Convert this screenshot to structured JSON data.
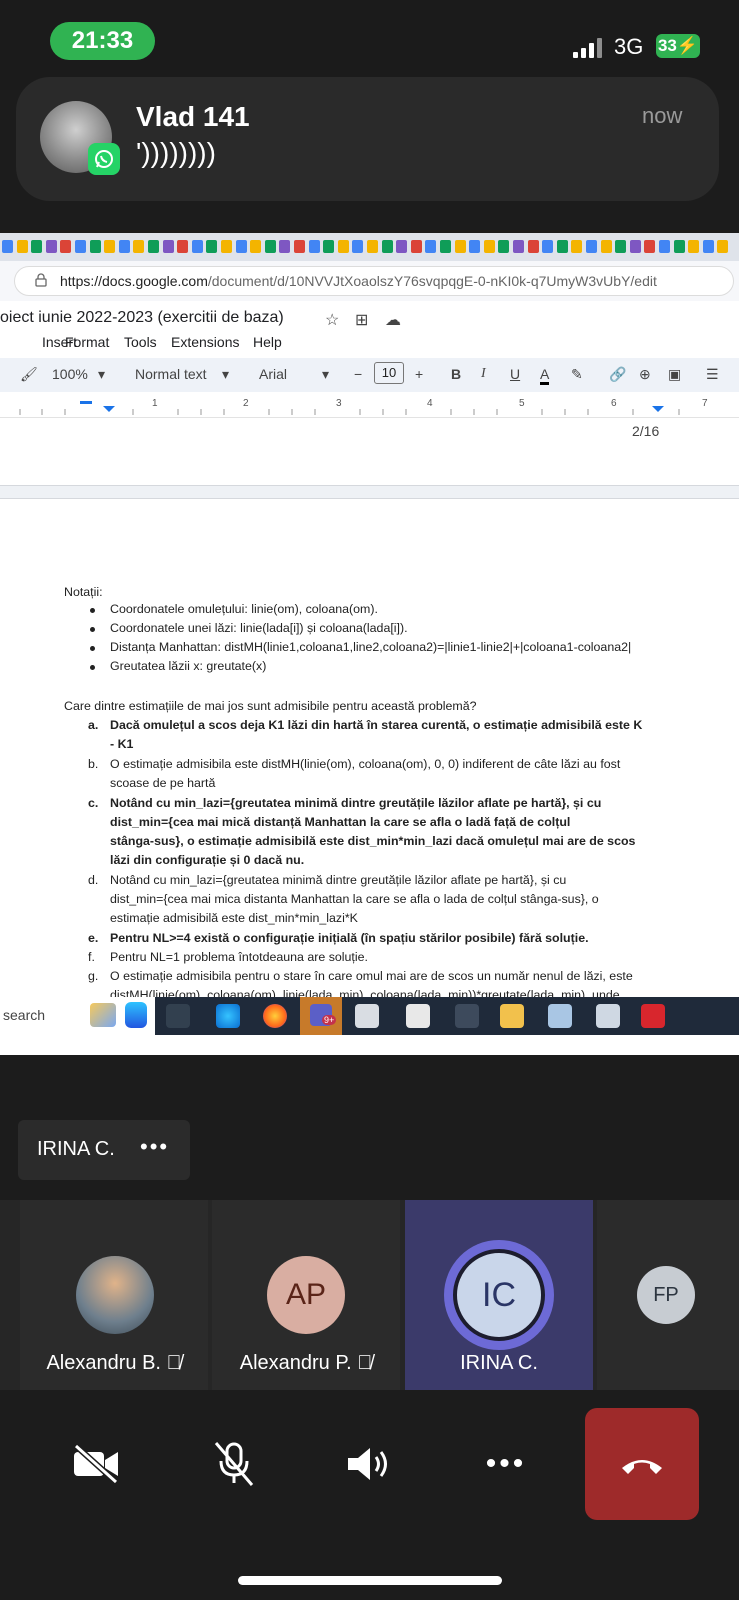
{
  "status_bar": {
    "time": "21:33",
    "network": "3G",
    "battery": "33"
  },
  "notification": {
    "sender": "Vlad 141",
    "message": "'))))))))",
    "time": "now",
    "app_icon": "whatsapp-icon"
  },
  "browser": {
    "url_host": "https://docs.google.com",
    "url_path": "/document/d/10NVVJtXoaolszY76svqpqgE-0-nKI0k-q7UmyW3vUbY/edit"
  },
  "docs": {
    "title": "oiect iunie 2022-2023 (exercitii de baza)",
    "menu": [
      "Insert",
      "Format",
      "Tools",
      "Extensions",
      "Help"
    ],
    "toolbar": {
      "zoom": "100%",
      "style": "Normal text",
      "font": "Arial",
      "font_size": "10"
    },
    "ruler": [
      "1",
      "2",
      "3",
      "4",
      "5",
      "6",
      "7"
    ],
    "page_count": "2/16"
  },
  "document": {
    "notatii": "Notații:",
    "bullets": [
      "Coordonatele omulețului: linie(om), coloana(om).",
      "Coordonatele unei lăzi: linie(lada[i]) și coloana(lada[i]).",
      "Distanța Manhattan: distMH(linie1,coloana1,line2,coloana2)=|linie1-linie2|+|coloana1-coloana2|",
      "Greutatea lăzii x: greutate(x)"
    ],
    "question": "Care dintre estimațiile de mai jos sunt admisibile pentru această problemă?",
    "options": [
      {
        "letter": "a.",
        "bold": true,
        "lines": [
          "Dacă omulețul a scos deja K1 lăzi din hartă în starea curentă, o estimație admisibilă este K",
          "- K1"
        ]
      },
      {
        "letter": "b.",
        "bold": false,
        "lines": [
          "O estimație admisibila este distMH(linie(om), coloana(om), 0, 0) indiferent de câte lăzi au fost",
          "scoase de pe hartă"
        ]
      },
      {
        "letter": "c.",
        "bold": true,
        "lines": [
          "Notând cu min_lazi={greutatea minimă dintre greutățile lăzilor aflate pe hartă}, și cu",
          "dist_min={cea mai mică distanță Manhattan la care se afla o ladă față de colțul",
          "stânga-sus}, o estimație admisibilă este dist_min*min_lazi dacă omulețul mai are de scos",
          "lăzi din configurație și 0 dacă nu."
        ]
      },
      {
        "letter": "d.",
        "bold": false,
        "lines": [
          "Notând cu min_lazi={greutatea minimă dintre greutățile lăzilor aflate pe hartă}, și cu",
          "dist_min={cea mai mica distanta Manhattan la care se afla o lada de colțul stânga-sus}, o",
          "estimație admisibilă este dist_min*min_lazi*K"
        ]
      },
      {
        "letter": "e.",
        "bold": true,
        "lines": [
          "Pentru NL>=4 există o configurație inițială (în spațiu stărilor posibile) fără soluție."
        ]
      },
      {
        "letter": "f.",
        "bold": false,
        "lines": [
          "Pentru NL=1 problema întotdeauna are soluție."
        ]
      },
      {
        "letter": "g.",
        "bold": false,
        "lines": [
          "O estimație admisibila pentru o stare în care omul mai are de scos un număr nenul de lăzi, este",
          "distMH(linie(om), coloana(om), linie(lada_min), coloana(lada_min))*greutate(lada_min), unde"
        ]
      }
    ]
  },
  "taskbar": {
    "search_label": "search",
    "teams_badge": "9+"
  },
  "call": {
    "presenter": {
      "name": "IRINA C.",
      "more": "•••"
    },
    "participants": [
      {
        "name": "Alexandru B.",
        "initials": "",
        "muted": true
      },
      {
        "name": "Alexandru P.",
        "initials": "AP",
        "muted": true
      },
      {
        "name": "IRINA C.",
        "initials": "IC",
        "muted": false
      },
      {
        "name": "",
        "initials": "FP",
        "muted": false
      }
    ],
    "more_label": "•••"
  }
}
